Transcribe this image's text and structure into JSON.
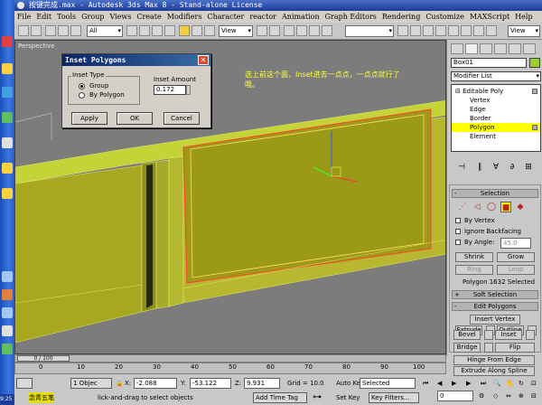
{
  "title": "按键完成.max - Autodesk 3ds Max 8 - Stand-alone License",
  "menu": [
    "File",
    "Edit",
    "Tools",
    "Group",
    "Views",
    "Create",
    "Modifiers",
    "Character",
    "reactor",
    "Animation",
    "Graph Editors",
    "Rendering",
    "Customize",
    "MAXScript",
    "Help"
  ],
  "toolbar": {
    "filter_select": "All",
    "coord_select": "View",
    "view_select_right": "View"
  },
  "viewport": {
    "label": "Perspective",
    "annotation": "选上前这个面，Inset进去一点点，一点点就行了哦。"
  },
  "dialog": {
    "title": "Inset Polygons",
    "group_label": "Inset Type",
    "option_group": "Group",
    "option_by_polygon": "By Polygon",
    "amount_label": "Inset Amount",
    "amount_value": "0.172",
    "apply": "Apply",
    "ok": "OK",
    "cancel": "Cancel"
  },
  "panel": {
    "object_name": "Box01",
    "object_color": "#9acd32",
    "modifier_list": "Modifier List",
    "stack": [
      "Editable Poly",
      "Vertex",
      "Edge",
      "Border",
      "Polygon",
      "Element"
    ],
    "selection_header": "Selection",
    "by_vertex": "By Vertex",
    "ignore_backfacing": "Ignore Backfacing",
    "by_angle": "By Angle:",
    "angle_value": "45.0",
    "shrink": "Shrink",
    "grow": "Grow",
    "ring": "Ring",
    "loop": "Loop",
    "selected_status": "Polygon 1632 Selected",
    "soft_selection": "Soft Selection",
    "edit_polygons": "Edit Polygons",
    "insert_vertex": "Insert Vertex",
    "extrude": "Extrude",
    "outline": "Outline",
    "bevel": "Bevel",
    "inset": "Inset",
    "bridge": "Bridge",
    "flip": "Flip",
    "hinge_from_edge": "Hinge From Edge",
    "extrude_along_spline": "Extrude Along Spline"
  },
  "timeline": {
    "frame": "0 / 100",
    "ticks": [
      "0",
      "10",
      "20",
      "30",
      "40",
      "50",
      "60",
      "70",
      "80",
      "90",
      "100"
    ]
  },
  "status": {
    "objects": "1 Objec",
    "x_label": "X:",
    "x_value": "-2.088",
    "y_label": "Y:",
    "y_value": "-53.122",
    "z_label": "Z:",
    "z_value": "9.931",
    "grid": "Grid = 10.0",
    "auto_key": "Auto Key",
    "selected_dropdown": "Selected",
    "set_key": "Set Key",
    "key_filters": "Key Filters...",
    "prompt": "lick-and-drag to select objects",
    "add_time_tag": "Add Time Tag",
    "frame_field": "0",
    "ime": "念青五笔",
    "clock": "9:25"
  }
}
